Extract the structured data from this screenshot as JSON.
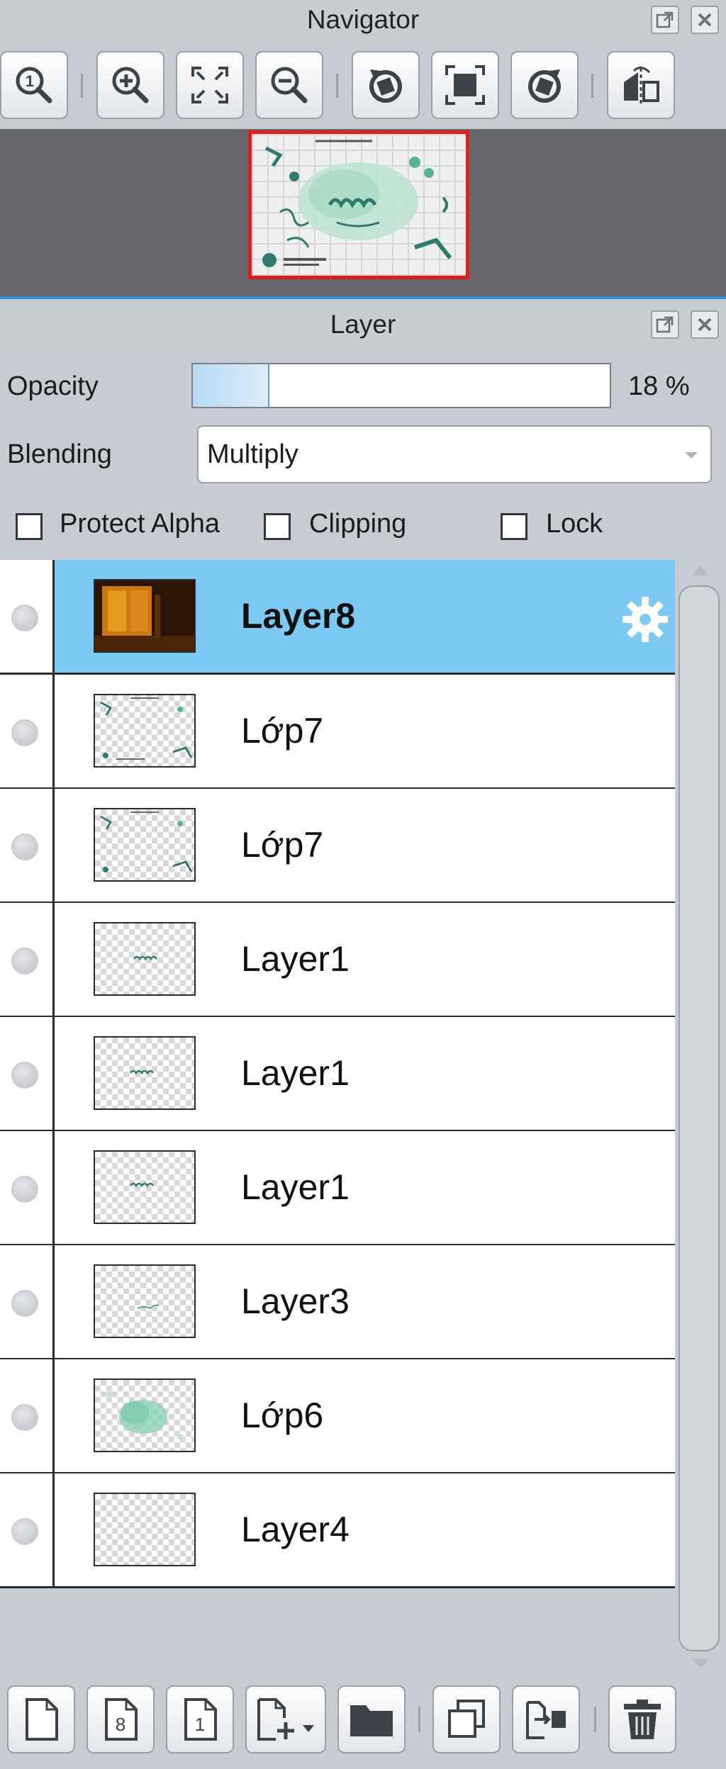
{
  "navigator": {
    "title": "Navigator",
    "toolbar": [
      {
        "icon": "zoom-actual-size-icon"
      },
      {
        "icon": "zoom-in-icon"
      },
      {
        "icon": "fit-to-window-icon"
      },
      {
        "icon": "zoom-out-icon"
      },
      {
        "icon": "rotate-left-icon"
      },
      {
        "icon": "reset-view-icon"
      },
      {
        "icon": "rotate-right-icon"
      },
      {
        "icon": "flip-horizontal-icon"
      }
    ]
  },
  "layer_panel": {
    "title": "Layer",
    "opacity_label": "Opacity",
    "opacity_value": "18 %",
    "opacity_fraction": 0.18,
    "blending_label": "Blending",
    "blending_value": "Multiply",
    "protect_alpha_label": "Protect Alpha",
    "clipping_label": "Clipping",
    "lock_label": "Lock",
    "layers": [
      {
        "name": "Layer8",
        "selected": true
      },
      {
        "name": "Lớp7"
      },
      {
        "name": "Lớp7"
      },
      {
        "name": "Layer1"
      },
      {
        "name": "Layer1"
      },
      {
        "name": "Layer1"
      },
      {
        "name": "Layer3"
      },
      {
        "name": "Lớp6"
      },
      {
        "name": "Layer4"
      }
    ]
  },
  "bottom_toolbar": [
    {
      "icon": "new-layer-icon"
    },
    {
      "icon": "new-8bit-layer-icon",
      "text": "8"
    },
    {
      "icon": "new-1bit-layer-icon",
      "text": "1"
    },
    {
      "icon": "add-layer-menu-icon"
    },
    {
      "icon": "new-folder-icon"
    },
    {
      "icon": "duplicate-layer-icon"
    },
    {
      "icon": "merge-down-icon"
    },
    {
      "icon": "delete-layer-icon"
    }
  ],
  "colors": {
    "selected_row": "#7ccaf3",
    "preview_border": "#e21d1d",
    "panel_bg": "#c8ccd2"
  }
}
